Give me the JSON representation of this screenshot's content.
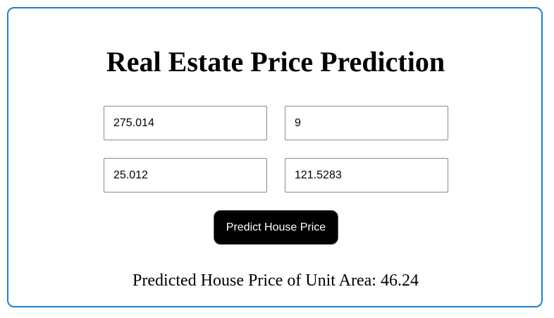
{
  "page": {
    "title": "Real Estate Price Prediction"
  },
  "form": {
    "fields": [
      {
        "value": "275.014"
      },
      {
        "value": "9"
      },
      {
        "value": "25.012"
      },
      {
        "value": "121.5283"
      }
    ],
    "predict_button_label": "Predict House Price"
  },
  "result": {
    "text": "Predicted House Price of Unit Area: 46.24"
  },
  "colors": {
    "card_border": "#1e7fd6",
    "button_background": "#000000",
    "button_text": "#ffffff"
  }
}
